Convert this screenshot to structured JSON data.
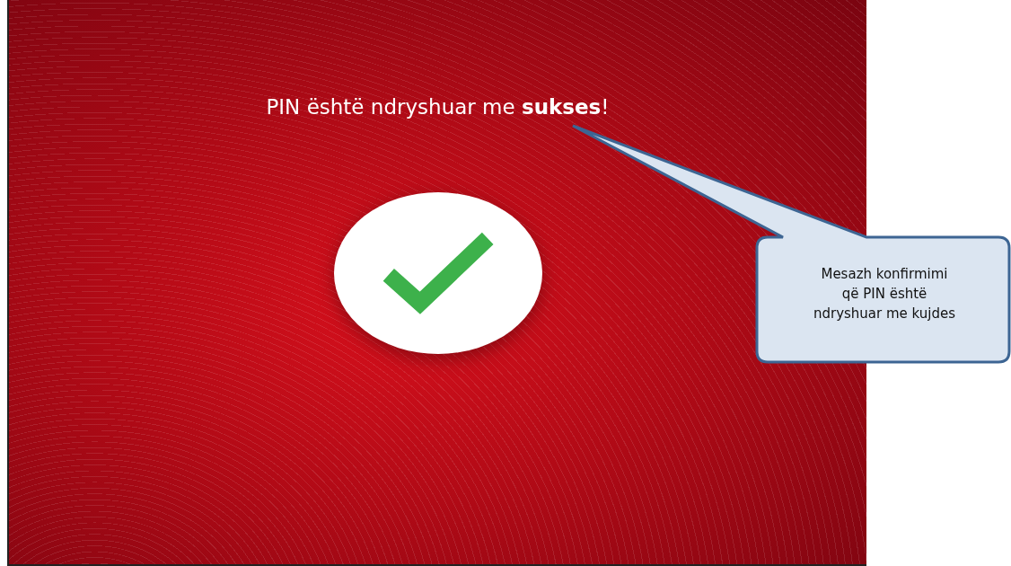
{
  "screen": {
    "message": "PIN është ndryshuar me **sukses**!"
  },
  "callout": {
    "text": "Mesazh konfirmimi që PIN është ndryshuar me kujdes"
  }
}
